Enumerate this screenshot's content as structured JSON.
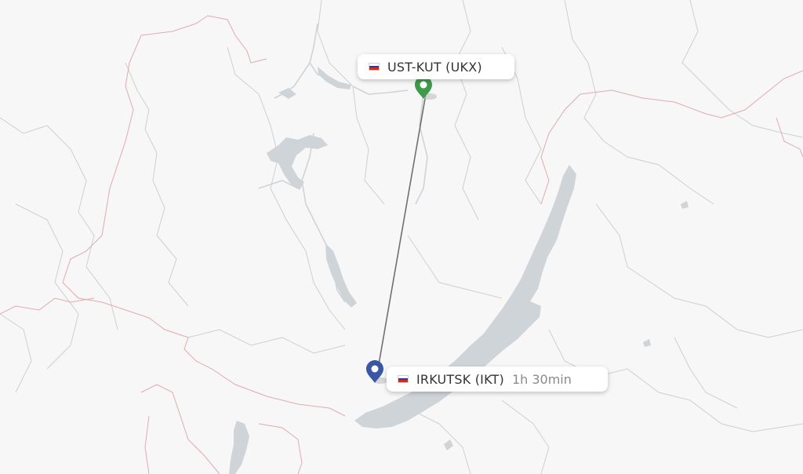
{
  "map": {
    "colors": {
      "background": "#f7f7f7",
      "water": "#cfd4d8",
      "admin_border": "#c7c7c7",
      "country_border": "#d9a6ad",
      "route_line": "#707070",
      "origin_pin": "#3f9b4b",
      "destination_pin": "#3a57a6"
    }
  },
  "origin": {
    "label": "UST-KUT (UKX)",
    "flag_icon": "russia-flag-icon",
    "pin_icon": "map-pin-icon"
  },
  "destination": {
    "label": "IRKUTSK (IKT)",
    "duration": "1h 30min",
    "flag_icon": "russia-flag-icon",
    "pin_icon": "map-pin-icon"
  }
}
